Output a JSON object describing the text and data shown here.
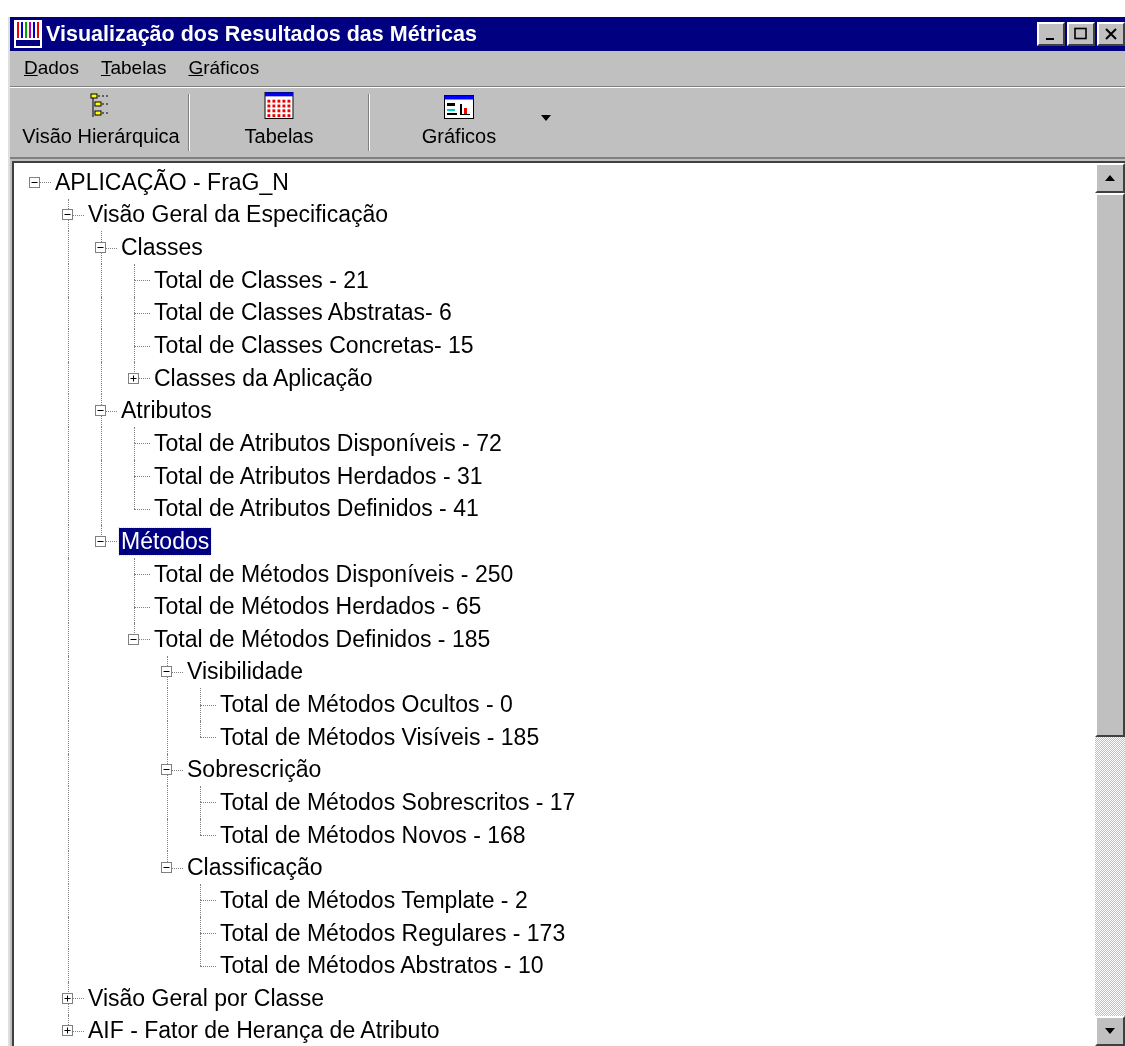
{
  "window": {
    "title": "Visualização dos Resultados das Métricas"
  },
  "menu": [
    {
      "label": "Dados"
    },
    {
      "label": "Tabelas"
    },
    {
      "label": "Gráficos"
    }
  ],
  "toolbar": [
    {
      "kind": "tree",
      "label": "Visão Hierárquica"
    },
    {
      "kind": "table",
      "label": "Tabelas"
    },
    {
      "kind": "chart",
      "label": "Gráficos",
      "dropdown": true
    }
  ],
  "tree": [
    {
      "label": "APLICAÇÃO - FraG_N",
      "expanded": true,
      "selected": false,
      "children": [
        {
          "label": "Visão Geral da Especificação",
          "expanded": true,
          "selected": false,
          "children": [
            {
              "label": "Classes",
              "expanded": true,
              "selected": false,
              "children": [
                {
                  "label": "Total de Classes - 21",
                  "selected": false
                },
                {
                  "label": "Total de Classes Abstratas- 6",
                  "selected": false
                },
                {
                  "label": "Total de Classes Concretas- 15",
                  "selected": false
                },
                {
                  "label": "Classes da Aplicação",
                  "expanded": false,
                  "selected": false
                }
              ]
            },
            {
              "label": "Atributos",
              "expanded": true,
              "selected": false,
              "children": [
                {
                  "label": "Total de Atributos Disponíveis - 72",
                  "selected": false
                },
                {
                  "label": "Total de Atributos Herdados - 31",
                  "selected": false
                },
                {
                  "label": "Total de Atributos Definidos - 41",
                  "selected": false
                }
              ]
            },
            {
              "label": "Métodos",
              "expanded": true,
              "selected": true,
              "children": [
                {
                  "label": "Total de Métodos Disponíveis - 250",
                  "selected": false
                },
                {
                  "label": "Total de Métodos Herdados - 65",
                  "selected": false
                },
                {
                  "label": "Total de Métodos Definidos - 185",
                  "expanded": true,
                  "selected": false,
                  "children": [
                    {
                      "label": "Visibilidade",
                      "expanded": true,
                      "selected": false,
                      "children": [
                        {
                          "label": "Total de Métodos Ocultos - 0",
                          "selected": false
                        },
                        {
                          "label": "Total de Métodos Visíveis - 185",
                          "selected": false
                        }
                      ]
                    },
                    {
                      "label": "Sobrescrição",
                      "expanded": true,
                      "selected": false,
                      "children": [
                        {
                          "label": "Total de Métodos Sobrescritos - 17",
                          "selected": false
                        },
                        {
                          "label": "Total de Métodos Novos - 168",
                          "selected": false
                        }
                      ]
                    },
                    {
                      "label": "Classificação",
                      "expanded": true,
                      "selected": false,
                      "children": [
                        {
                          "label": "Total de Métodos Template - 2",
                          "selected": false
                        },
                        {
                          "label": "Total de Métodos Regulares - 173",
                          "selected": false
                        },
                        {
                          "label": "Total de Métodos Abstratos - 10",
                          "selected": false
                        }
                      ]
                    }
                  ]
                }
              ]
            }
          ]
        },
        {
          "label": "Visão Geral por Classe",
          "expanded": false,
          "selected": false
        },
        {
          "label": "AIF - Fator de Herança de Atributo",
          "expanded": false,
          "selected": false
        }
      ]
    }
  ]
}
